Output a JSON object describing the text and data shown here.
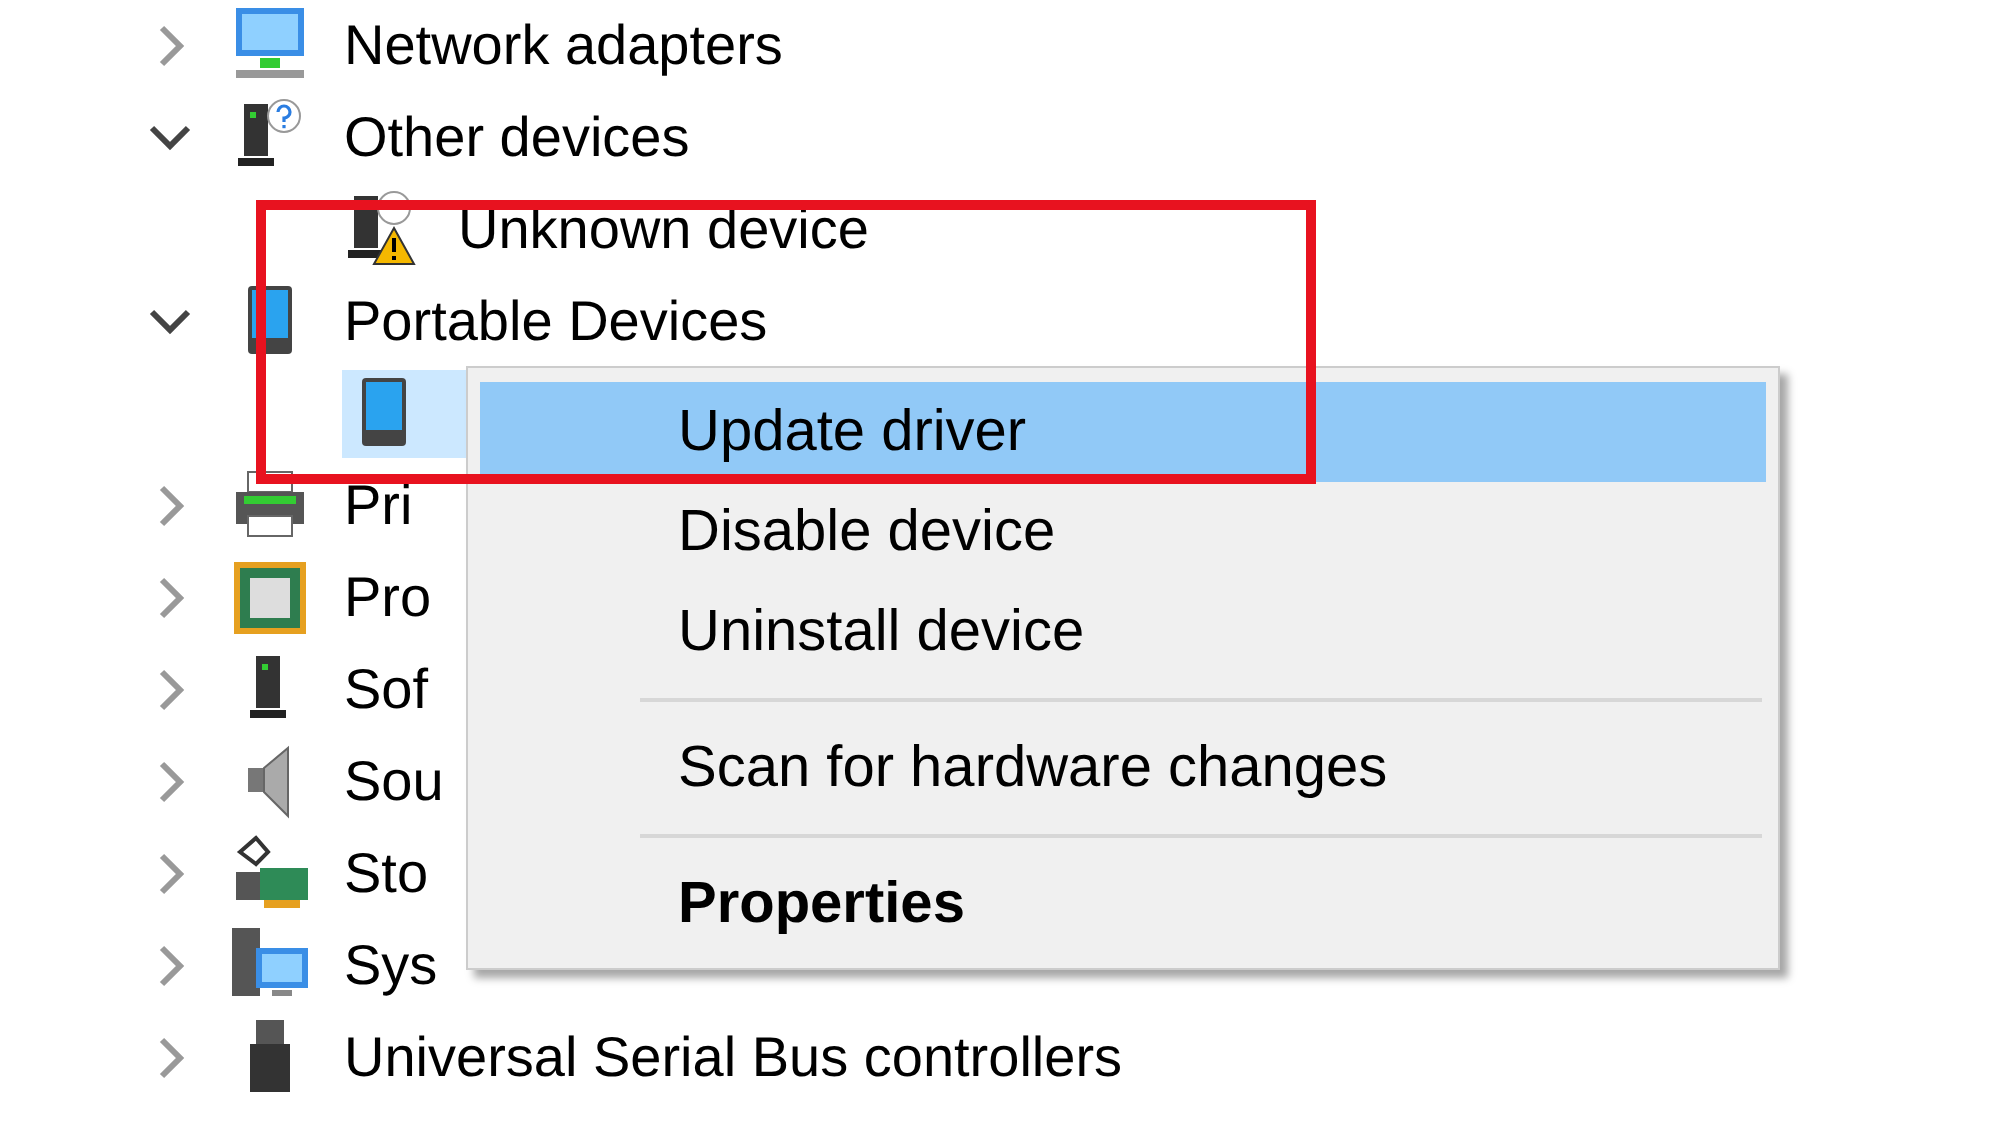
{
  "tree": [
    {
      "label": "Network adapters",
      "expanded": false,
      "selected": false
    },
    {
      "label": "Other devices",
      "expanded": true,
      "selected": false,
      "children": [
        {
          "label": "Unknown device",
          "selected": false
        }
      ]
    },
    {
      "label": "Portable Devices",
      "expanded": true,
      "selected": false,
      "children": [
        {
          "selected": true
        }
      ]
    },
    {
      "label": "Pri",
      "expanded": false,
      "selected": false
    },
    {
      "label": "Pro",
      "expanded": false,
      "selected": false
    },
    {
      "label": "Sof",
      "expanded": false,
      "selected": false
    },
    {
      "label": "Sou",
      "expanded": false,
      "selected": false
    },
    {
      "label": "Sto",
      "expanded": false,
      "selected": false
    },
    {
      "label": "Sys",
      "expanded": false,
      "selected": false
    },
    {
      "label": "Universal Serial Bus controllers",
      "expanded": false,
      "selected": false
    }
  ],
  "context_menu": {
    "items": [
      {
        "kind": "item",
        "label": "Update driver",
        "selected": true,
        "bold": false
      },
      {
        "kind": "item",
        "label": "Disable device",
        "selected": false,
        "bold": false
      },
      {
        "kind": "item",
        "label": "Uninstall device",
        "selected": false,
        "bold": false
      },
      {
        "kind": "separator"
      },
      {
        "kind": "item",
        "label": "Scan for hardware changes",
        "selected": false,
        "bold": false
      },
      {
        "kind": "separator"
      },
      {
        "kind": "item",
        "label": "Properties",
        "selected": false,
        "bold": true
      }
    ]
  }
}
